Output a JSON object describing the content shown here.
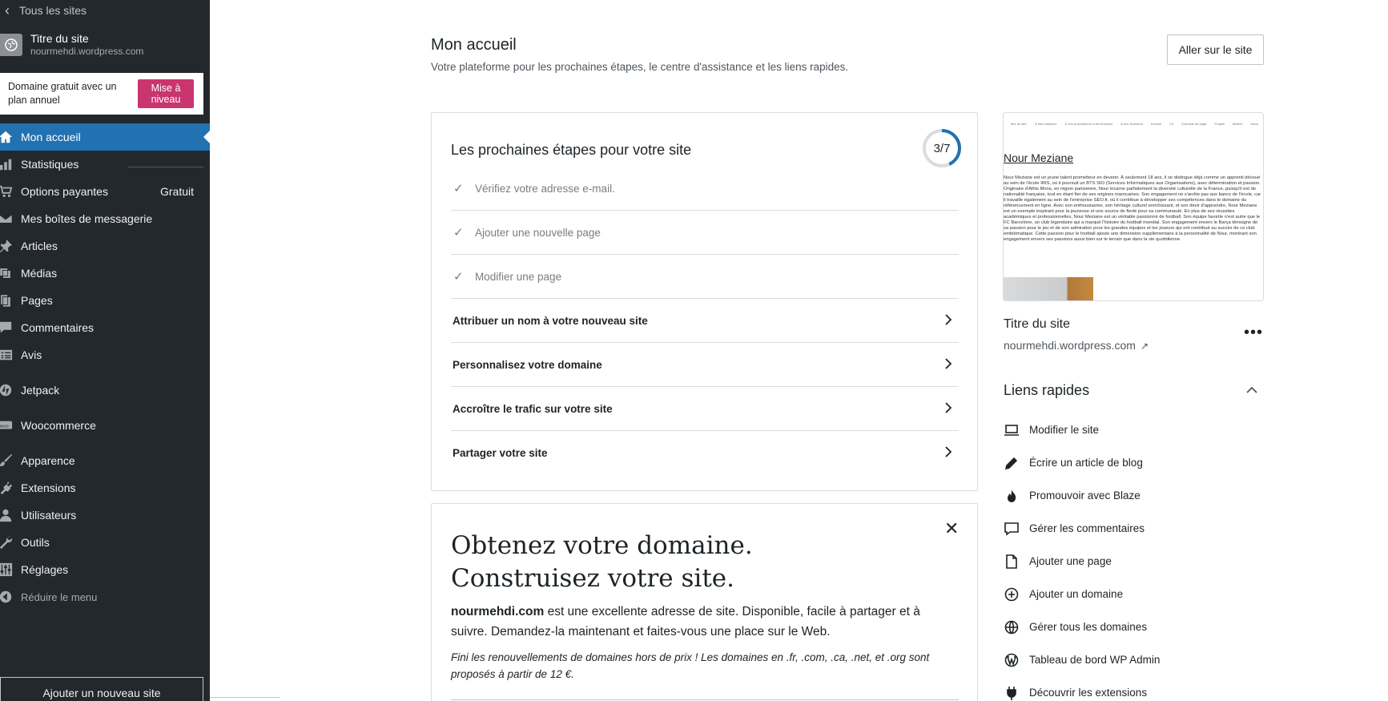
{
  "sidebar": {
    "all_sites": "Tous les sites",
    "site_title": "Titre du site",
    "site_url": "nourmehdi.wordpress.com",
    "upsell_text": "Domaine gratuit avec un plan annuel",
    "upsell_button": "Mise à niveau",
    "items": [
      {
        "label": "Mon accueil"
      },
      {
        "label": "Statistiques"
      },
      {
        "label": "Options payantes",
        "badge": "Gratuit"
      },
      {
        "label": "Mes boîtes de messagerie"
      },
      {
        "label": "Articles"
      },
      {
        "label": "Médias"
      },
      {
        "label": "Pages"
      },
      {
        "label": "Commentaires"
      },
      {
        "label": "Avis"
      },
      {
        "label": "Jetpack"
      },
      {
        "label": "Woocommerce"
      },
      {
        "label": "Apparence"
      },
      {
        "label": "Extensions"
      },
      {
        "label": "Utilisateurs"
      },
      {
        "label": "Outils"
      },
      {
        "label": "Réglages"
      },
      {
        "label": "Réduire le menu"
      }
    ],
    "add_site": "Ajouter un nouveau site"
  },
  "header": {
    "title": "Mon accueil",
    "subtitle": "Votre plateforme pour les prochaines étapes, le centre d'assistance et les liens rapides.",
    "visit_button": "Aller sur le site"
  },
  "steps": {
    "title": "Les prochaines étapes pour votre site",
    "progress_label": "3/7",
    "progress_fraction": 0.43,
    "accent_color": "#2271b1",
    "tasks": [
      {
        "label": "Vérifiez votre adresse e-mail.",
        "done": true
      },
      {
        "label": "Ajouter une nouvelle page",
        "done": true
      },
      {
        "label": "Modifier une page",
        "done": true
      },
      {
        "label": "Attribuer un nom à votre nouveau site",
        "done": false
      },
      {
        "label": "Personnalisez votre domaine",
        "done": false
      },
      {
        "label": "Accroître le trafic sur votre site",
        "done": false
      },
      {
        "label": "Partager votre site",
        "done": false
      }
    ]
  },
  "domain_card": {
    "heading_line1": "Obtenez votre domaine.",
    "heading_line2": "Construisez votre site.",
    "domain_name": "nourmehdi.com",
    "body": " est une excellente adresse de site. Disponible, facile à partager et à suivre. Demandez-la maintenant et faites-vous une place sur le Web.",
    "note": "Fini les renouvellements de domaines hors de prix ! Les domaines en .fr, .com, .ca, .net, et .org sont proposés à partir de 12 €."
  },
  "preview": {
    "nav_site": "Titre du site",
    "nav_items": [
      "A Mes tableaux",
      "A Vos propositions et les finances",
      "A Vos Scolaires",
      "Accueil",
      "CV",
      "Exemple de page",
      "Projets",
      "Mathur",
      "Nanu"
    ],
    "heading": "Nour Meziane",
    "text": "Nour Meziane est un jeune talent prometteur en devenir. À seulement 18 ans, il se distingue déjà comme un apprenti dévoué au sein de l'école IRIS, où il poursuit un BTS SIO (Services Informatiques aux Organisations), avec détermination et passion. Originaire d'Athis Mons, en région parisienne, Nour incarne parfaitement la diversité culturelle de la France, puisqu'il est de nationalité française, tout en étant fier de ses origines marocaines. Son engagement ne s'arrête pas aux bancs de l'école, car il travaille également au sein de l'entreprise SEO.fr, où il contribue à développer ses compétences dans le domaine du référencement en ligne. Avec son enthousiasme, son héritage culturel enrichissant, et son désir d'apprendre, Nour Meziane est un exemple inspirant pour la jeunesse et une source de fierté pour sa communauté. En plus de ses réussites académiques et professionnelles, Nour Meziane est un véritable passionné de football. Son équipe favorite n'est autre que le FC Barcelone, un club légendaire qui a marqué l'histoire du football mondial. Son engagement envers le Barça témoigne de sa passion pour le jeu et de son admiration pour les grandes équipes et les joueurs qui ont contribué au succès de ce club emblématique. Cette passion pour le football ajoute une dimension supplémentaire à la personnalité de Nour, montrant son engagement envers ses passions aussi bien sur le terrain que dans la vie quotidienne."
  },
  "site_info": {
    "title": "Titre du site",
    "url": "nourmehdi.wordpress.com",
    "more": "•••"
  },
  "quick_links": {
    "title": "Liens rapides",
    "items": [
      {
        "label": "Modifier le site",
        "icon": "laptop-icon"
      },
      {
        "label": "Écrire un article de blog",
        "icon": "pencil-icon"
      },
      {
        "label": "Promouvoir avec Blaze",
        "icon": "flame-icon"
      },
      {
        "label": "Gérer les commentaires",
        "icon": "comment-icon"
      },
      {
        "label": "Ajouter une page",
        "icon": "page-icon"
      },
      {
        "label": "Ajouter un domaine",
        "icon": "plus-circle-icon"
      },
      {
        "label": "Gérer tous les domaines",
        "icon": "globe-icon"
      },
      {
        "label": "Tableau de bord WP Admin",
        "icon": "wordpress-icon"
      },
      {
        "label": "Découvrir les extensions",
        "icon": "plug-icon"
      }
    ]
  }
}
